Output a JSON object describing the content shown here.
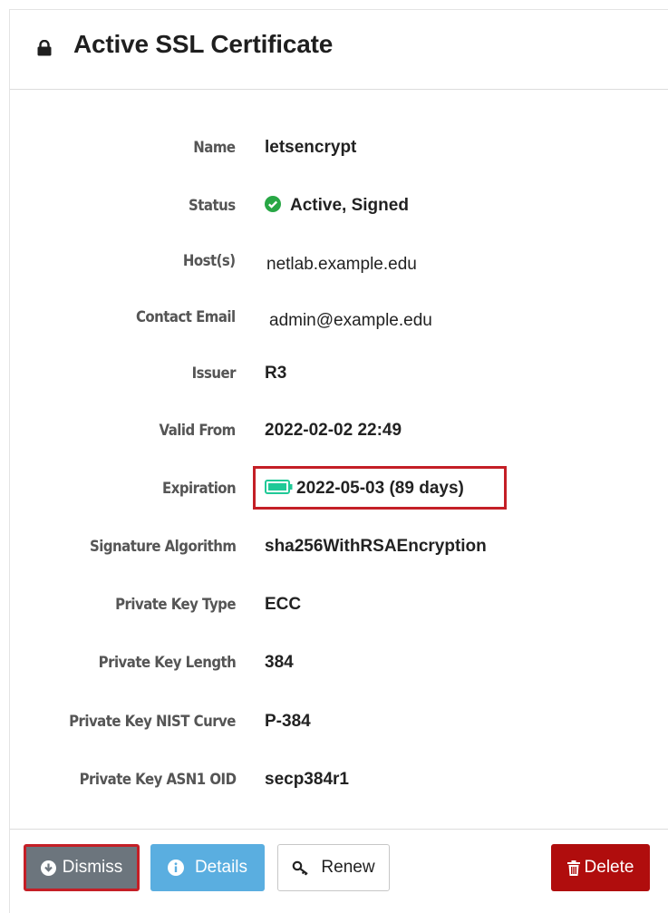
{
  "header": {
    "title": "Active SSL Certificate",
    "icon": "lock-icon"
  },
  "fields": [
    {
      "label": "Name",
      "value": "letsencrypt"
    },
    {
      "label": "Status",
      "value": "Active, Signed",
      "icon": "check-circle-icon",
      "icon_color": "#28a745"
    },
    {
      "label": "Host(s)",
      "value": "netlab.example.edu"
    },
    {
      "label": "Contact Email",
      "value": "admin@example.edu"
    },
    {
      "label": "Issuer",
      "value": "R3"
    },
    {
      "label": "Valid From",
      "value": "2022-02-02 22:49"
    },
    {
      "label": "Expiration",
      "value": "2022-05-03 (89 days)",
      "icon": "battery-full-icon",
      "icon_color": "#20c997"
    },
    {
      "label": "Signature Algorithm",
      "value": "sha256WithRSAEncryption"
    },
    {
      "label": "Private Key Type",
      "value": "ECC"
    },
    {
      "label": "Private Key Length",
      "value": "384"
    },
    {
      "label": "Private Key NIST Curve",
      "value": "P-384"
    },
    {
      "label": "Private Key ASN1 OID",
      "value": "secp384r1"
    }
  ],
  "buttons": {
    "dismiss": "Dismiss",
    "details": "Details",
    "renew": "Renew",
    "delete": "Delete"
  },
  "colors": {
    "dismiss_bg": "#6c757d",
    "details_bg": "#5aaee0",
    "delete_bg": "#b00d0d",
    "highlight_border": "#c41f26"
  }
}
